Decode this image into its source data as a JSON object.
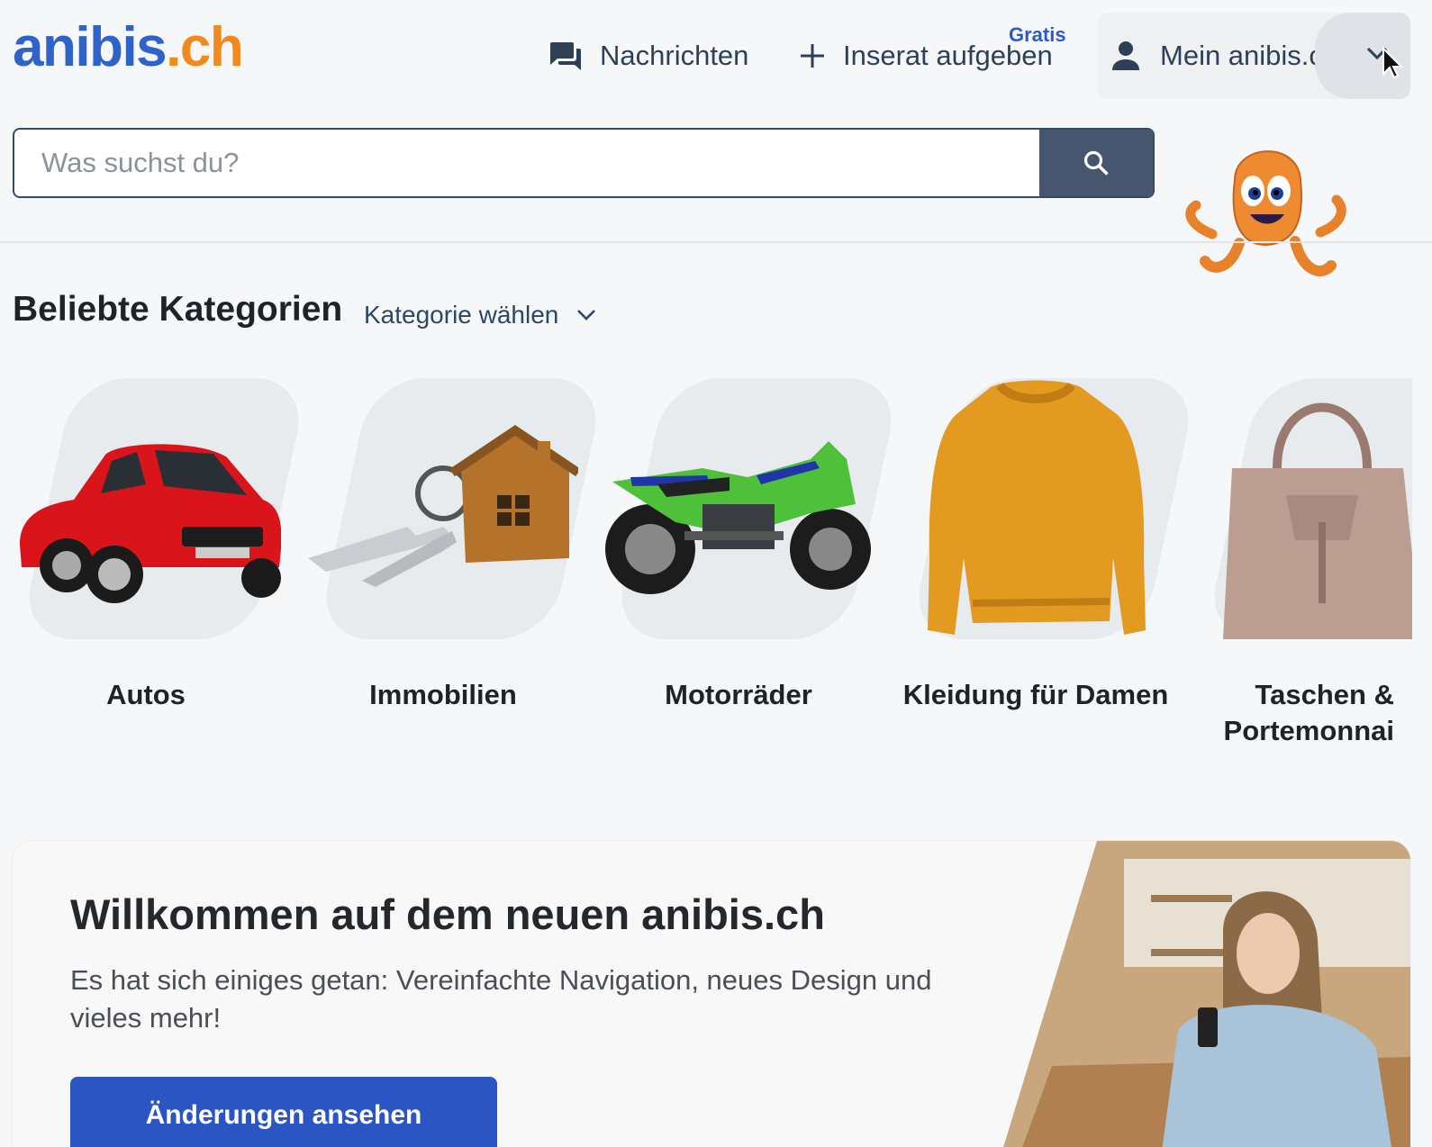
{
  "header": {
    "logo": {
      "part1": "anibis",
      "part2": ".ch"
    },
    "messages_label": "Nachrichten",
    "post_ad_label": "Inserat aufgeben",
    "post_ad_badge": "Gratis",
    "account_label": "Mein anibis.ch"
  },
  "search": {
    "placeholder": "Was suchst du?"
  },
  "categories": {
    "title": "Beliebte Kategorien",
    "select_label": "Kategorie wählen",
    "items": [
      {
        "label": "Autos",
        "icon": "car-image"
      },
      {
        "label": "Immobilien",
        "icon": "house-keys-image"
      },
      {
        "label": "Motorräder",
        "icon": "motorcycle-image"
      },
      {
        "label": "Kleidung für Damen",
        "icon": "sweater-image"
      },
      {
        "label_line1": "Taschen &",
        "label_line2": "Portemonnai",
        "icon": "handbag-image"
      }
    ]
  },
  "banner": {
    "title": "Willkommen auf dem neuen anibis.ch",
    "text": "Es hat sich einiges getan: Vereinfachte Navigation, neues Design und vieles mehr!",
    "button_label": "Änderungen ansehen"
  },
  "colors": {
    "brand_blue": "#2f63c8",
    "brand_orange": "#f08a1c",
    "search_button": "#46566f",
    "primary_button": "#2c55c4"
  }
}
